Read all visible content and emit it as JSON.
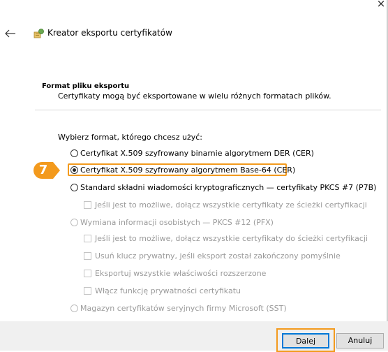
{
  "window": {
    "close_glyph": "×",
    "title": "Kreator eksportu certyfikatów",
    "back_icon": "back-arrow-icon",
    "wizard_icon": "certificate-wizard-icon"
  },
  "header": {
    "title": "Format pliku eksportu",
    "description": "Certyfikaty mogą być eksportowane w wielu różnych formatach plików."
  },
  "form": {
    "prompt": "Wybierz format, którego chcesz użyć:",
    "options": [
      {
        "label": "Certyfikat X.509 szyfrowany binarnie algorytmem DER (CER)",
        "checked": false,
        "enabled": true
      },
      {
        "label": "Certyfikat X.509 szyfrowany algorytmem Base-64 (CER)",
        "checked": true,
        "enabled": true
      },
      {
        "label": "Standard składni wiadomości kryptograficznych — certyfikaty PKCS #7 (P7B)",
        "checked": false,
        "enabled": true
      },
      {
        "label": "Wymiana informacji osobistych — PKCS #12 (PFX)",
        "checked": false,
        "enabled": false
      },
      {
        "label": "Magazyn certyfikatów seryjnych firmy Microsoft (SST)",
        "checked": false,
        "enabled": false
      }
    ],
    "checkboxes": [
      {
        "label": "Jeśli jest to możliwe, dołącz wszystkie certyfikaty ze ścieżki certyfikacji",
        "checked": false,
        "enabled": false
      },
      {
        "label": "Jeśli jest to możliwe, dołącz wszystkie certyfikaty do ścieżki certyfikacji",
        "checked": false,
        "enabled": false
      },
      {
        "label": "Usuń klucz prywatny, jeśli eksport został zakończony pomyślnie",
        "checked": false,
        "enabled": false
      },
      {
        "label": "Eksportuj wszystkie właściwości rozszerzone",
        "checked": false,
        "enabled": false
      },
      {
        "label": "Włącz funkcję prywatności certyfikatu",
        "checked": false,
        "enabled": false
      }
    ]
  },
  "annotation": {
    "step": "7",
    "color": "#f39a1d"
  },
  "footer": {
    "next_label": "Dalej",
    "cancel_label": "Anuluj"
  }
}
